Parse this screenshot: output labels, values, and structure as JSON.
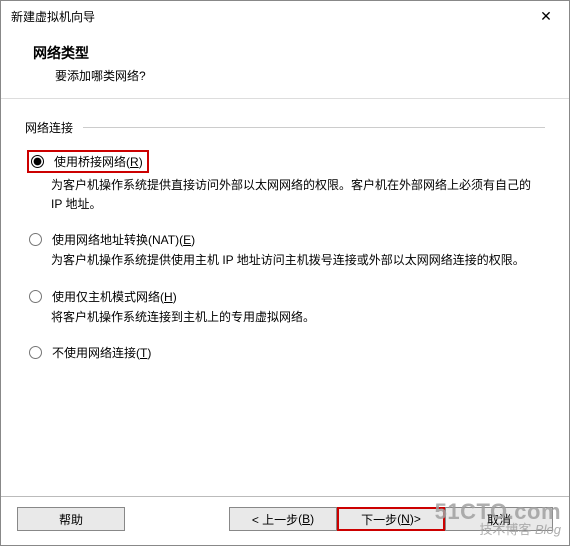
{
  "titlebar": {
    "title": "新建虚拟机向导",
    "close_glyph": "✕"
  },
  "header": {
    "title": "网络类型",
    "subtitle": "要添加哪类网络?"
  },
  "fieldset": {
    "legend": "网络连接"
  },
  "options": [
    {
      "id": "bridged",
      "selected": true,
      "label_pre": "使用桥接网络",
      "hotkey": "R",
      "desc": "为客户机操作系统提供直接访问外部以太网网络的权限。客户机在外部网络上必须有自己的 IP 地址。"
    },
    {
      "id": "nat",
      "selected": false,
      "label_pre": "使用网络地址转换(NAT)",
      "hotkey": "E",
      "desc": "为客户机操作系统提供使用主机 IP 地址访问主机拨号连接或外部以太网网络连接的权限。"
    },
    {
      "id": "hostonly",
      "selected": false,
      "label_pre": "使用仅主机模式网络",
      "hotkey": "H",
      "desc": "将客户机操作系统连接到主机上的专用虚拟网络。"
    },
    {
      "id": "none",
      "selected": false,
      "label_pre": "不使用网络连接",
      "hotkey": "T"
    }
  ],
  "footer": {
    "help": "帮助",
    "back_pre": "< 上一步",
    "back_hotkey": "B",
    "next_pre": "下一步",
    "next_hotkey": "N",
    "next_post": " >",
    "cancel": "取消"
  },
  "watermark": {
    "line1": "51CTO.com",
    "line2a": "技术博客",
    "line2b": "Blog"
  }
}
